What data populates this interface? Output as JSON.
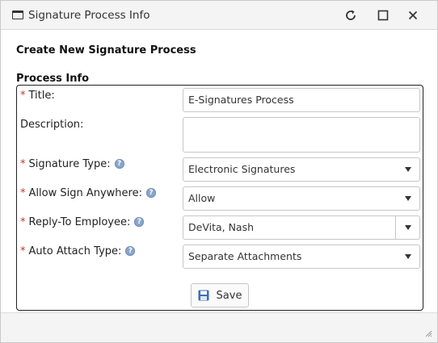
{
  "window": {
    "title": "Signature Process Info",
    "icons": {
      "app": "window-icon",
      "refresh": "refresh-icon",
      "maximize": "maximize-icon",
      "close": "close-icon"
    }
  },
  "form": {
    "heading": "Create New Signature Process",
    "section_label": "Process Info",
    "required_marker": "*",
    "fields": {
      "title": {
        "label": "Title:",
        "value": "E-Signatures Process"
      },
      "description": {
        "label": "Description:",
        "value": ""
      },
      "signature_type": {
        "label": "Signature Type:",
        "value": "Electronic Signatures"
      },
      "allow_sign_anywhere": {
        "label": "Allow Sign Anywhere:",
        "value": "Allow"
      },
      "reply_to_employee": {
        "label": "Reply-To Employee:",
        "value": "DeVita, Nash"
      },
      "auto_attach_type": {
        "label": "Auto Attach Type:",
        "value": "Separate Attachments"
      }
    },
    "help_icon_glyph": "?",
    "save_label": "Save"
  },
  "colors": {
    "required": "#c0392b",
    "help_icon": "#8aa6c9",
    "save_icon": "#3b6fb0"
  }
}
